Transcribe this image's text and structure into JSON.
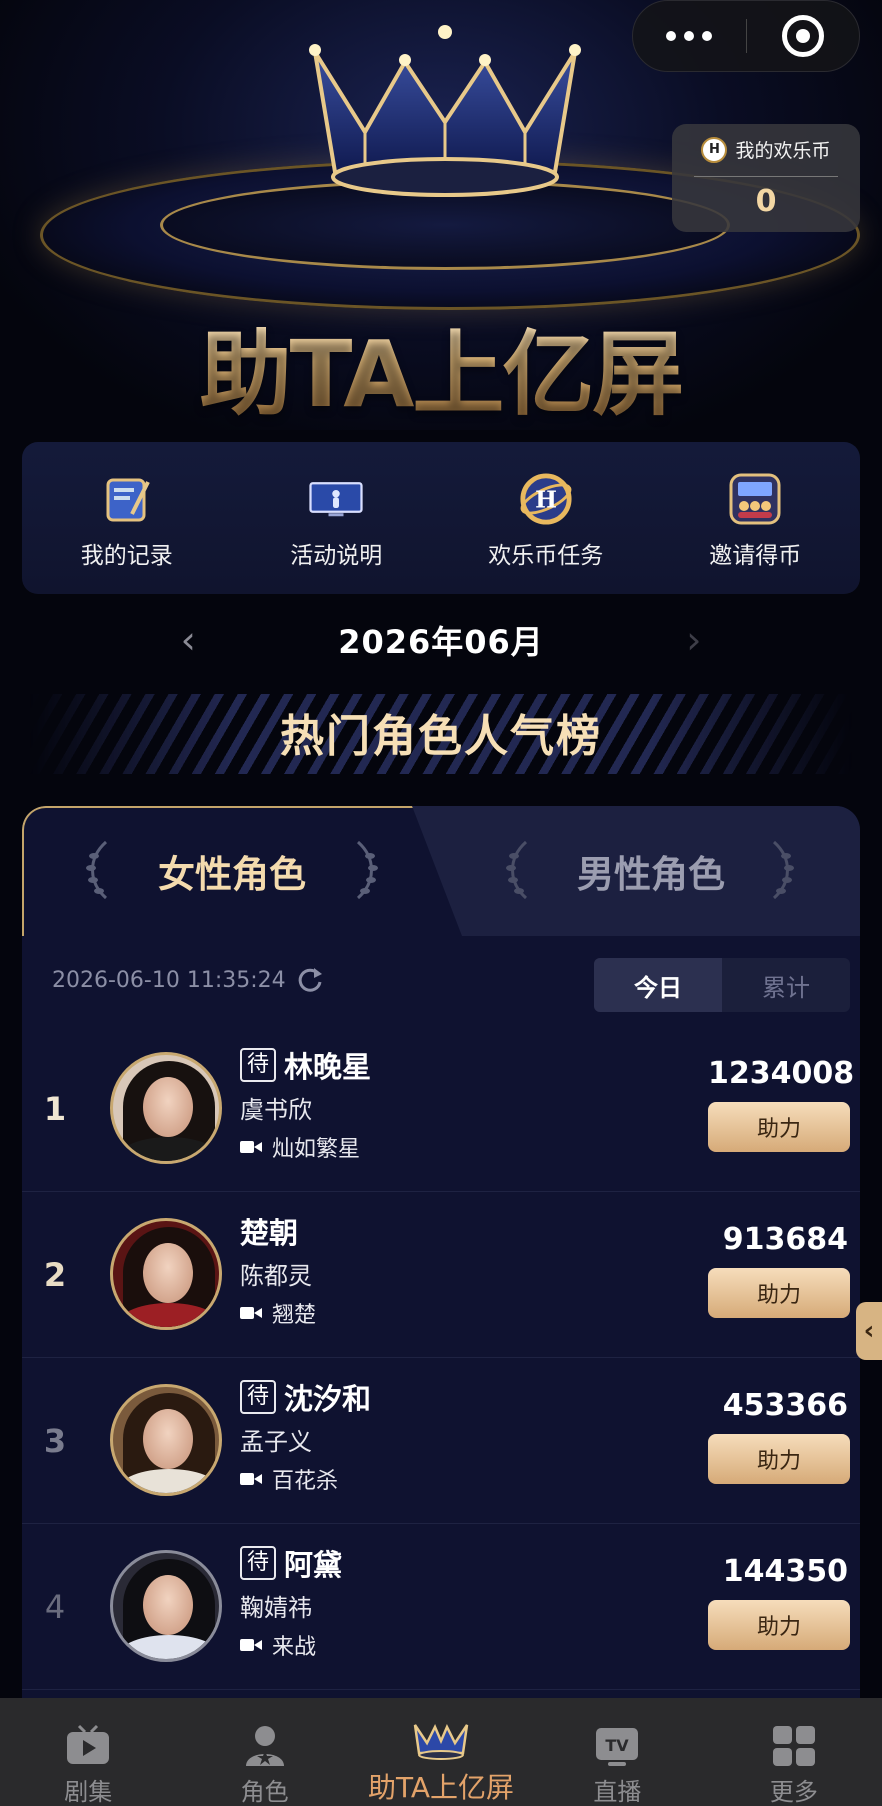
{
  "header": {
    "title": "助TA上亿屏",
    "coins_label": "我的欢乐币",
    "coins_value": "0"
  },
  "menu": [
    {
      "label": "我的记录",
      "icon": "notebook-icon"
    },
    {
      "label": "活动说明",
      "icon": "screen-icon"
    },
    {
      "label": "欢乐币任务",
      "icon": "h-coin-icon"
    },
    {
      "label": "邀请得币",
      "icon": "audience-icon"
    }
  ],
  "month": {
    "current": "2026年06月"
  },
  "section": {
    "title": "热门角色人气榜"
  },
  "tabs": {
    "female": "女性角色",
    "male": "男性角色"
  },
  "meta": {
    "timestamp": "2026-06-10 11:35:24",
    "today": "今日",
    "total": "累计"
  },
  "rows": [
    {
      "rank": "1",
      "tag": "待",
      "name": "林晚星",
      "actor": "虞书欣",
      "drama": "灿如繁星",
      "score": "1234008",
      "button": "助力"
    },
    {
      "rank": "2",
      "tag": "",
      "name": "楚朝",
      "actor": "陈都灵",
      "drama": "翘楚",
      "score": "913684",
      "button": "助力"
    },
    {
      "rank": "3",
      "tag": "待",
      "name": "沈汐和",
      "actor": "孟子义",
      "drama": "百花杀",
      "score": "453366",
      "button": "助力"
    },
    {
      "rank": "4",
      "tag": "待",
      "name": "阿黛",
      "actor": "鞠婧祎",
      "drama": "来战",
      "score": "144350",
      "button": "助力"
    }
  ],
  "nav": [
    {
      "label": "剧集",
      "icon": "tv-play-icon"
    },
    {
      "label": "角色",
      "icon": "person-star-icon"
    },
    {
      "label": "助TA上亿屏",
      "icon": "crown-icon",
      "active": true
    },
    {
      "label": "直播",
      "icon": "tv-icon"
    },
    {
      "label": "更多",
      "icon": "grid-icon"
    }
  ],
  "colors": {
    "accent_gold": "#f4dbae",
    "active_nav": "#e3a36a",
    "panel": "#0f1230"
  }
}
